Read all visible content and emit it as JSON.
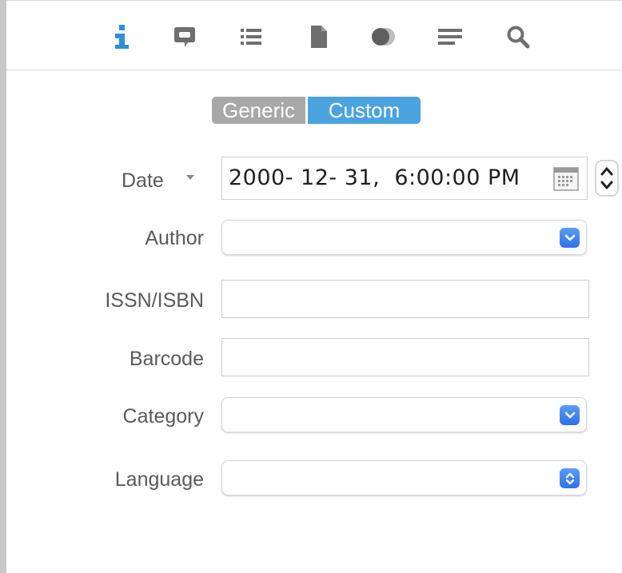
{
  "toolbar": {
    "icons": [
      "info-icon",
      "comment-icon",
      "list-icon",
      "document-icon",
      "color-icon",
      "text-lines-icon",
      "search-icon"
    ],
    "active_color": "#2f8fd6",
    "icon_color": "#6e6e6e"
  },
  "segmented": {
    "generic_label": "Generic",
    "custom_label": "Custom",
    "selected": "Custom",
    "selected_color": "#4aa3df"
  },
  "fields": {
    "date": {
      "label": "Date",
      "value": "2000- 12- 31,  6:00:00 PM"
    },
    "author": {
      "label": "Author",
      "value": ""
    },
    "issn": {
      "label": "ISSN/ISBN",
      "value": ""
    },
    "barcode": {
      "label": "Barcode",
      "value": ""
    },
    "category": {
      "label": "Category",
      "value": ""
    },
    "language": {
      "label": "Language",
      "value": ""
    }
  }
}
